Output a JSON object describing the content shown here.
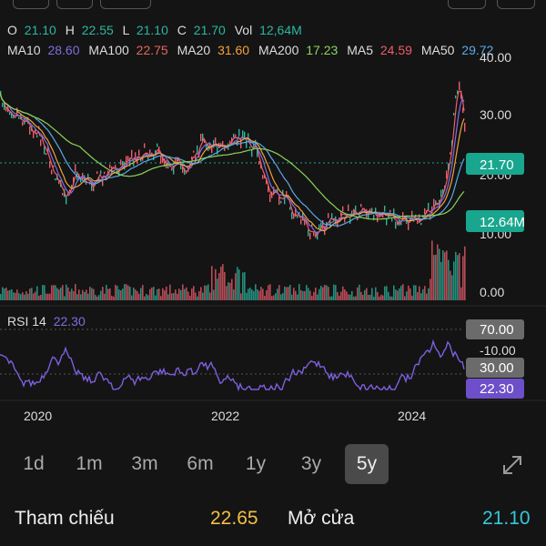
{
  "ohlc": {
    "o_label": "O",
    "o_value": "21.10",
    "h_label": "H",
    "h_value": "22.55",
    "l_label": "L",
    "l_value": "21.10",
    "c_label": "C",
    "c_value": "21.70",
    "vol_label": "Vol",
    "vol_value": "12,64M"
  },
  "ma": [
    {
      "label": "MA10",
      "value": "28.60",
      "color": "#7d6fe0"
    },
    {
      "label": "MA100",
      "value": "22.75",
      "color": "#e0695b"
    },
    {
      "label": "MA20",
      "value": "31.60",
      "color": "#f2a23a"
    },
    {
      "label": "MA200",
      "value": "17.23",
      "color": "#8cd35a"
    },
    {
      "label": "MA5",
      "value": "24.59",
      "color": "#ee5d6c"
    },
    {
      "label": "MA50",
      "value": "29.72",
      "color": "#5aa9e6"
    }
  ],
  "price_axis": [
    "40.00",
    "30.00",
    "20.00",
    "10.00",
    "0.00"
  ],
  "price_tags": {
    "close": "21.70",
    "volume": "12.64M"
  },
  "rsi": {
    "label": "RSI 14",
    "value": "22.30",
    "axis": [
      "70.00",
      "-10.00",
      "30.00"
    ],
    "tag": "22.30"
  },
  "x_axis": [
    "2020",
    "2022",
    "2024"
  ],
  "timeframes": [
    "1d",
    "1m",
    "3m",
    "6m",
    "1y",
    "3y",
    "5y"
  ],
  "active_timeframe": "5y",
  "info": {
    "ref_label": "Tham chiếu",
    "ref_value": "22.65",
    "open_label": "Mở cửa",
    "open_value": "21.10"
  },
  "colors": {
    "background": "#141414",
    "up": "#2bb7a0",
    "down": "#ee5d6c",
    "rsi_line": "#7d5fe0",
    "ref_value": "#f4bf45",
    "open_value": "#35c8d8",
    "close_tag": "#19a68e",
    "rsi_tag": "#6d4fc9"
  }
}
